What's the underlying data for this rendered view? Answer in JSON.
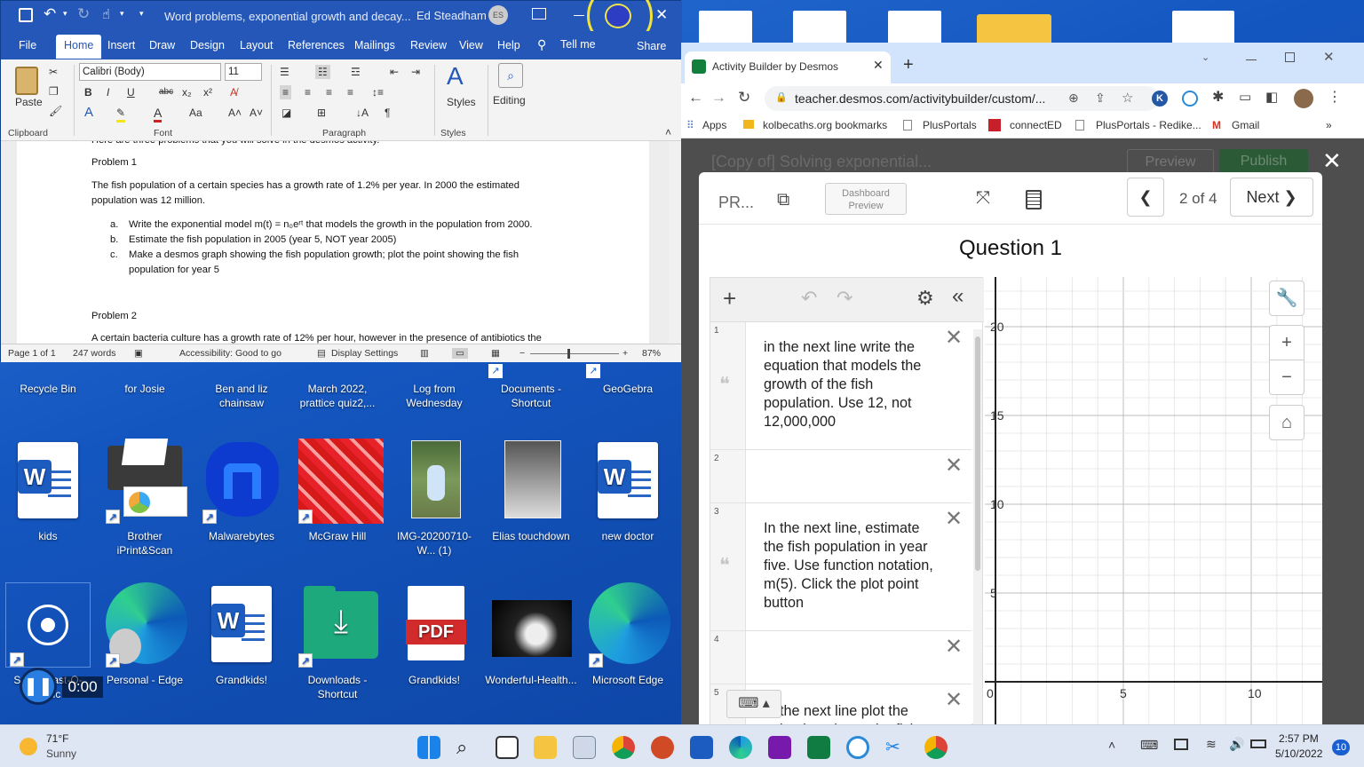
{
  "desktop": {
    "icons": [
      {
        "label": "Recycle Bin"
      },
      {
        "label": "for Josie"
      },
      {
        "label": "Ben and liz chainsaw"
      },
      {
        "label": "March 2022, prattice quiz2,..."
      },
      {
        "label": "Log from Wednesday"
      },
      {
        "label": "Documents - Shortcut"
      },
      {
        "label": "GeoGebra"
      },
      {
        "label": "kids"
      },
      {
        "label": "Brother iPrint&Scan"
      },
      {
        "label": "Malwarebytes"
      },
      {
        "label": "McGraw Hill"
      },
      {
        "label": "IMG-20200710-W... (1)"
      },
      {
        "label": "Elias touchdown"
      },
      {
        "label": "new doctor"
      },
      {
        "label": "Screencast-O-Matic"
      },
      {
        "label": "Personal - Edge"
      },
      {
        "label": "Grandkids!"
      },
      {
        "label": "Downloads - Shortcut"
      },
      {
        "label": "Grandkids!"
      },
      {
        "label": "Wonderful-Health..."
      },
      {
        "label": "Microsoft Edge"
      }
    ],
    "recorder_timer": "0:00"
  },
  "word": {
    "title": "Word problems, exponential growth and decay...",
    "user": "Ed Steadham",
    "user_initials": "ES",
    "menus": [
      "File",
      "Home",
      "Insert",
      "Draw",
      "Design",
      "Layout",
      "References",
      "Mailings",
      "Review",
      "View",
      "Help"
    ],
    "tell_me": "Tell me",
    "share": "Share",
    "ribbon": {
      "paste": "Paste",
      "clipboard": "Clipboard",
      "font_name": "Calibri (Body)",
      "font_size": "11",
      "font": "Font",
      "paragraph": "Paragraph",
      "styles": "Styles",
      "styles_group": "Styles",
      "editing": "Editing"
    },
    "doc": {
      "intro": "Here are three problems that you will solve in the desmos activity.",
      "problem1_title": "Problem 1",
      "problem1_line1": "The fish population of a certain species has a growth rate of 1.2% per year. In 2000 the estimated",
      "problem1_line2": "population was 12 million.",
      "item_a_marker": "a.",
      "item_a_text": "Write the exponential model m(t) = n₀eʳᵗ that models the growth in the population from 2000.",
      "item_b_marker": "b.",
      "item_b_text": "Estimate the fish population in 2005 (year 5, NOT year 2005)",
      "item_c_marker": "c.",
      "item_c_text1": "Make a desmos graph showing the fish population growth; plot the point showing the fish",
      "item_c_text2": "population for year 5",
      "problem2_title": "Problem 2",
      "problem2_line1": "A certain bacteria culture has a growth rate of 12% per hour, however in the presence of antibiotics the"
    },
    "status": {
      "page": "Page 1 of 1",
      "words": "247 words",
      "accessibility": "Accessibility: Good to go",
      "display_settings": "Display Settings",
      "zoom": "87%"
    }
  },
  "chrome": {
    "tab_title": "Activity Builder by Desmos",
    "url": "teacher.desmos.com/activitybuilder/custom/...",
    "bookmarks": [
      "Apps",
      "kolbecaths.org bookmarks",
      "PlusPortals",
      "connectED",
      "PlusPortals - Redike...",
      "Gmail"
    ],
    "bg_title": "[Copy of] Solving exponential...",
    "bg_preview": "Preview",
    "bg_publish": "Publish"
  },
  "desmos": {
    "pr_label": "PR...",
    "dashboard_preview": "Dashboard Preview",
    "pager": "2 of 4",
    "next": "Next",
    "question_title": "Question 1",
    "expressions": [
      {
        "num": "1",
        "text": "in the next line write the equation that models the growth of the fish population. Use 12, not 12,000,000"
      },
      {
        "num": "2",
        "text": ""
      },
      {
        "num": "3",
        "text": "In the next line, estimate the fish population in year five. Use function notation, m(5). Click the plot point button"
      },
      {
        "num": "4",
        "text": ""
      },
      {
        "num": "5",
        "text": "In the next line plot the point that shows the fish"
      }
    ],
    "graph": {
      "y_ticks": [
        "20",
        "15",
        "10",
        "5"
      ],
      "x_ticks": [
        "0",
        "5",
        "10"
      ]
    }
  },
  "taskbar": {
    "temp": "71°F",
    "weather": "Sunny",
    "time": "2:57 PM",
    "date": "5/10/2022",
    "notifications": "10"
  }
}
